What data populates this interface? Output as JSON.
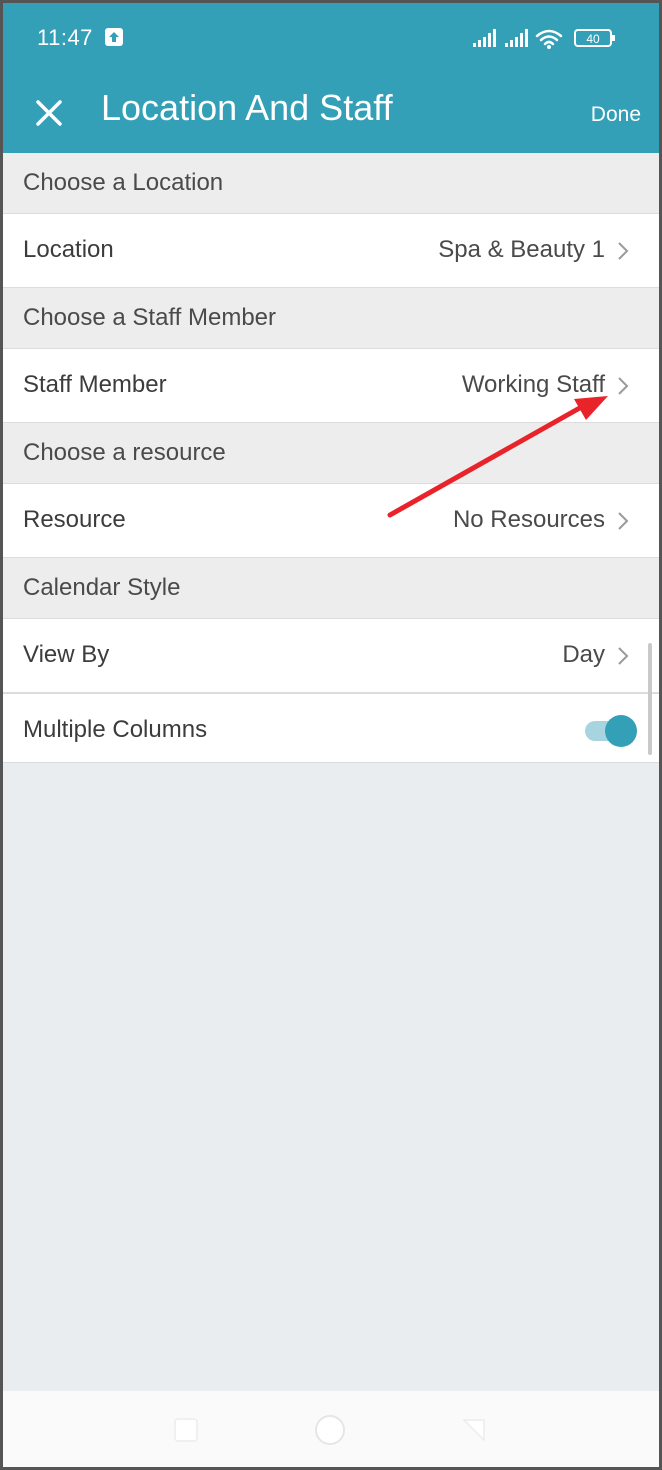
{
  "status_bar": {
    "time": "11:47",
    "battery": "40"
  },
  "header": {
    "title": "Location And Staff",
    "done_label": "Done"
  },
  "sections": {
    "location": {
      "header": "Choose a Location",
      "label": "Location",
      "value": "Spa & Beauty 1"
    },
    "staff": {
      "header": "Choose a Staff Member",
      "label": "Staff Member",
      "value": "Working Staff"
    },
    "resource": {
      "header": "Choose a resource",
      "label": "Resource",
      "value": "No Resources"
    },
    "calendar": {
      "header": "Calendar Style",
      "view_by_label": "View By",
      "view_by_value": "Day",
      "multiple_columns_label": "Multiple Columns",
      "multiple_columns_on": true
    }
  },
  "colors": {
    "primary": "#33a0b7",
    "annotation_arrow": "#e8232a"
  },
  "icons": [
    "upload-icon",
    "signal-icon",
    "wifi-icon",
    "battery-icon",
    "close-icon",
    "chevron-right-icon",
    "home-icon",
    "recents-icon",
    "back-icon"
  ]
}
